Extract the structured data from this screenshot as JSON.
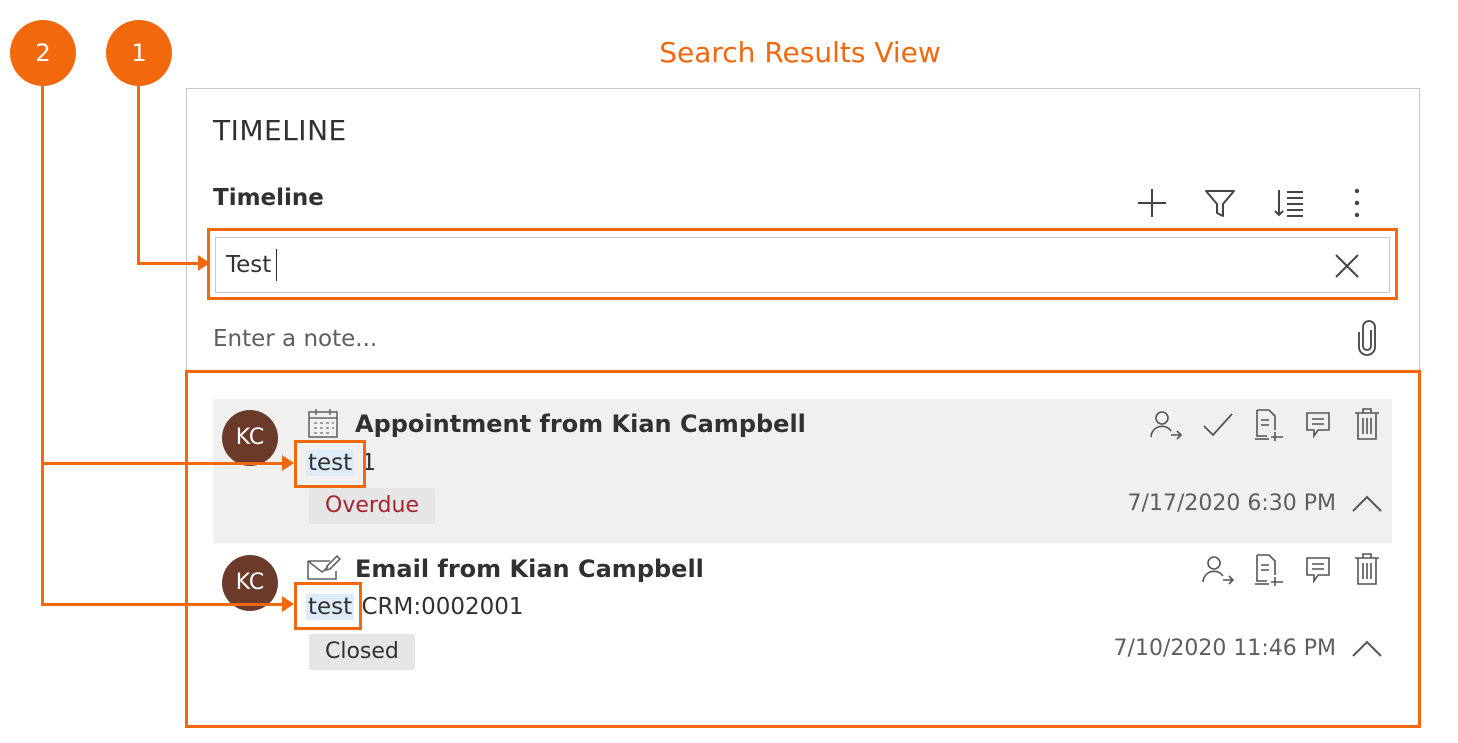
{
  "callouts": {
    "one": "1",
    "two": "2"
  },
  "page_title": "Search Results View",
  "timeline": {
    "heading": "TIMELINE",
    "subheading": "Timeline",
    "search": {
      "value": "Test"
    },
    "note_placeholder": "Enter a note...",
    "records": [
      {
        "avatar": "KC",
        "type_icon": "calendar-icon",
        "title": "Appointment from Kian Campbell",
        "match": "test",
        "rest": " 1",
        "status": "Overdue",
        "datetime": "7/17/2020 6:30 PM"
      },
      {
        "avatar": "KC",
        "type_icon": "email-icon",
        "title": "Email from Kian Campbell",
        "match": "test",
        "rest": " CRM:0002001",
        "status": "Closed",
        "datetime": "7/10/2020 11:46 PM"
      }
    ]
  },
  "colors": {
    "accent": "#f2690d",
    "avatar": "#6b3a2a",
    "overdue_text": "#a4262c",
    "selected_row": "#f0f0f0",
    "match_highlight": "#deecf9"
  }
}
